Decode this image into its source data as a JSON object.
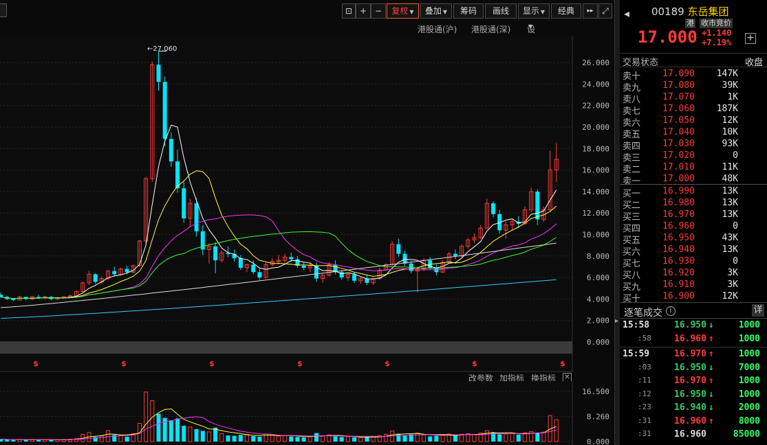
{
  "toolbar": {
    "buttons": [
      {
        "name": "lock-icon",
        "label": "⊡"
      },
      {
        "name": "zoom-in-button",
        "label": "+"
      },
      {
        "name": "zoom-out-button",
        "label": "−"
      },
      {
        "name": "fuquan-button",
        "label": "复权",
        "active": true
      },
      {
        "name": "overlay-button",
        "label": "叠加"
      },
      {
        "name": "chips-button",
        "label": "筹码"
      },
      {
        "name": "draw-button",
        "label": "画线"
      },
      {
        "name": "display-button",
        "label": "显示"
      },
      {
        "name": "classic-button",
        "label": "经典"
      },
      {
        "name": "forward-button",
        "label": "▸▸"
      },
      {
        "name": "fullscreen-button",
        "label": "⤢"
      }
    ]
  },
  "links": {
    "hk_sh": "港股通(沪)",
    "hk_sz": "港股通(深)",
    "ma_settings": "设置均线"
  },
  "indicator_bar": {
    "edit": "改参数",
    "add": "加指标",
    "switch": "换指标",
    "close": "✕"
  },
  "colors": {
    "up": "#ff3b3b",
    "down": "#00e5ff",
    "ma5": "#ffffff",
    "ma10": "#ffff33",
    "ma20": "#ff33ff",
    "ma30": "#33ff33",
    "ma60": "#dddddd",
    "ma120": "#33ccff"
  },
  "chart_data": {
    "type": "candlestick",
    "peak_label": "←27.060",
    "y_axis_ticks": [
      "26.000",
      "24.000",
      "22.000",
      "20.000",
      "18.000",
      "16.000",
      "14.000",
      "12.000",
      "10.000",
      "8.000",
      "6.000",
      "4.000",
      "2.000",
      "0.000"
    ],
    "ylim": [
      0,
      27.5
    ],
    "volume_axis_ticks": [
      "16.500",
      "8.260",
      "0.000"
    ],
    "volume_ylim": [
      0,
      16.5
    ],
    "dividend_marker": "$",
    "candles": [
      [
        4.4,
        4.6,
        4.1,
        4.2
      ],
      [
        4.2,
        4.3,
        3.9,
        4.0
      ],
      [
        4.0,
        4.1,
        3.8,
        3.9
      ],
      [
        3.9,
        4.3,
        3.9,
        4.2
      ],
      [
        4.2,
        4.2,
        3.9,
        4.0
      ],
      [
        4.0,
        4.3,
        3.9,
        4.2
      ],
      [
        4.2,
        4.4,
        4.0,
        4.1
      ],
      [
        4.1,
        4.3,
        4.0,
        4.2
      ],
      [
        4.2,
        4.3,
        3.9,
        4.0
      ],
      [
        4.0,
        4.2,
        3.9,
        4.1
      ],
      [
        4.1,
        4.3,
        4.0,
        4.2
      ],
      [
        4.2,
        4.4,
        4.1,
        4.3
      ],
      [
        4.3,
        4.8,
        4.2,
        4.7
      ],
      [
        4.7,
        5.6,
        4.6,
        5.5
      ],
      [
        5.5,
        6.6,
        5.3,
        6.3
      ],
      [
        6.3,
        6.4,
        5.4,
        5.6
      ],
      [
        5.6,
        6.1,
        5.4,
        5.9
      ],
      [
        5.9,
        6.7,
        5.8,
        6.6
      ],
      [
        6.6,
        7.0,
        6.1,
        6.3
      ],
      [
        6.3,
        6.9,
        6.2,
        6.8
      ],
      [
        6.8,
        7.1,
        6.3,
        6.5
      ],
      [
        6.5,
        7.2,
        6.4,
        7.1
      ],
      [
        7.1,
        9.5,
        7.0,
        9.4
      ],
      [
        9.4,
        15.4,
        9.2,
        15.2
      ],
      [
        15.2,
        26.1,
        14.9,
        25.8
      ],
      [
        25.8,
        27.06,
        23.4,
        24.2
      ],
      [
        24.2,
        24.7,
        18.2,
        18.9
      ],
      [
        18.9,
        19.5,
        16.3,
        16.8
      ],
      [
        16.8,
        17.9,
        13.9,
        14.3
      ],
      [
        14.3,
        14.9,
        11.1,
        11.5
      ],
      [
        11.5,
        13.3,
        10.7,
        12.9
      ],
      [
        12.9,
        13.4,
        9.8,
        10.3
      ],
      [
        10.3,
        10.9,
        8.1,
        8.6
      ],
      [
        8.6,
        9.2,
        7.3,
        8.9
      ],
      [
        8.9,
        9.3,
        6.4,
        7.6
      ],
      [
        7.6,
        8.5,
        7.4,
        8.3
      ],
      [
        8.3,
        8.9,
        7.9,
        8.2
      ],
      [
        8.2,
        8.6,
        7.5,
        7.8
      ],
      [
        7.8,
        8.1,
        6.7,
        6.9
      ],
      [
        6.9,
        7.3,
        6.5,
        7.2
      ],
      [
        7.2,
        7.6,
        6.3,
        6.5
      ],
      [
        6.5,
        6.8,
        5.8,
        6.0
      ],
      [
        6.0,
        7.5,
        5.9,
        7.2
      ],
      [
        7.2,
        7.8,
        7.0,
        7.5
      ],
      [
        7.5,
        8.1,
        7.2,
        7.6
      ],
      [
        7.6,
        8.2,
        7.4,
        7.9
      ],
      [
        7.9,
        8.3,
        7.5,
        7.7
      ],
      [
        7.7,
        8.0,
        6.9,
        7.1
      ],
      [
        7.1,
        7.4,
        6.7,
        6.9
      ],
      [
        6.9,
        7.3,
        6.5,
        7.1
      ],
      [
        7.1,
        7.4,
        5.6,
        5.9
      ],
      [
        5.9,
        6.4,
        5.5,
        6.2
      ],
      [
        6.2,
        7.4,
        6.1,
        7.2
      ],
      [
        7.2,
        7.6,
        6.3,
        6.5
      ],
      [
        6.5,
        6.7,
        5.8,
        6.0
      ],
      [
        6.0,
        6.4,
        5.7,
        6.3
      ],
      [
        6.3,
        6.5,
        5.5,
        5.7
      ],
      [
        5.7,
        6.1,
        5.4,
        5.9
      ],
      [
        5.9,
        6.2,
        5.3,
        5.5
      ],
      [
        5.5,
        6.0,
        5.3,
        5.9
      ],
      [
        5.9,
        6.9,
        5.8,
        6.7
      ],
      [
        6.7,
        7.3,
        6.6,
        7.2
      ],
      [
        7.2,
        9.4,
        7.1,
        9.1
      ],
      [
        9.1,
        9.6,
        7.9,
        8.2
      ],
      [
        8.2,
        8.5,
        7.1,
        7.3
      ],
      [
        7.3,
        7.6,
        6.4,
        6.6
      ],
      [
        6.6,
        7.0,
        4.6,
        6.8
      ],
      [
        6.8,
        7.8,
        6.6,
        7.6
      ],
      [
        7.6,
        7.9,
        6.7,
        6.9
      ],
      [
        6.9,
        7.2,
        6.2,
        6.5
      ],
      [
        6.5,
        7.6,
        6.4,
        7.4
      ],
      [
        7.4,
        8.4,
        7.3,
        8.2
      ],
      [
        8.2,
        8.6,
        7.7,
        8.0
      ],
      [
        8.0,
        9.1,
        7.9,
        8.9
      ],
      [
        8.9,
        9.7,
        8.7,
        9.5
      ],
      [
        9.5,
        10.1,
        9.2,
        9.7
      ],
      [
        9.7,
        10.9,
        9.6,
        10.6
      ],
      [
        10.6,
        13.3,
        10.5,
        12.9
      ],
      [
        12.9,
        13.1,
        11.6,
        11.9
      ],
      [
        11.9,
        12.3,
        10.1,
        10.4
      ],
      [
        10.4,
        11.2,
        9.6,
        10.9
      ],
      [
        10.9,
        11.4,
        10.4,
        11.2
      ],
      [
        11.2,
        11.7,
        10.6,
        11.0
      ],
      [
        11.0,
        12.6,
        10.9,
        12.3
      ],
      [
        12.3,
        14.4,
        12.1,
        14.0
      ],
      [
        14.0,
        14.2,
        10.9,
        11.4
      ],
      [
        11.4,
        12.6,
        11.2,
        12.3
      ],
      [
        12.3,
        17.8,
        12.2,
        16.0
      ],
      [
        16.0,
        18.5,
        14.9,
        17.0
      ]
    ],
    "volumes": [
      0.8,
      0.6,
      0.5,
      0.7,
      0.6,
      0.7,
      0.5,
      0.6,
      0.5,
      0.6,
      0.7,
      0.8,
      1.0,
      2.4,
      3.0,
      1.5,
      1.8,
      3.6,
      2.2,
      2.0,
      1.6,
      2.6,
      6.0,
      16.3,
      13.5,
      9.2,
      7.8,
      7.0,
      7.6,
      5.2,
      4.8,
      4.1,
      3.5,
      3.2,
      4.6,
      2.6,
      2.0,
      1.9,
      2.2,
      2.4,
      1.8,
      1.6,
      2.5,
      2.1,
      1.8,
      2.0,
      1.7,
      1.5,
      1.4,
      1.6,
      2.8,
      1.9,
      2.2,
      1.7,
      1.5,
      1.6,
      1.4,
      1.3,
      1.6,
      1.5,
      2.0,
      2.4,
      3.5,
      2.6,
      2.1,
      2.4,
      2.8,
      2.2,
      1.7,
      1.9,
      2.1,
      2.5,
      2.0,
      2.4,
      2.6,
      2.3,
      2.8,
      3.6,
      3.1,
      2.4,
      2.5,
      2.7,
      2.3,
      2.9,
      3.3,
      2.8,
      3.1,
      8.6,
      7.2
    ]
  },
  "quote": {
    "back": "◂",
    "code": "00189",
    "name": "东岳集团",
    "tag1": "港",
    "tag2": "收市竞价",
    "price": "17.000",
    "change": "+1.140",
    "pct": "+7.19%",
    "add": "+",
    "trade_status_label": "交易状态",
    "trade_status_value": "收盘"
  },
  "order_book": [
    {
      "label": "卖十",
      "price": "17.090",
      "vol": "147K"
    },
    {
      "label": "卖九",
      "price": "17.080",
      "vol": "39K"
    },
    {
      "label": "卖八",
      "price": "17.070",
      "vol": "1K"
    },
    {
      "label": "卖七",
      "price": "17.060",
      "vol": "187K"
    },
    {
      "label": "卖六",
      "price": "17.050",
      "vol": "12K"
    },
    {
      "label": "卖五",
      "price": "17.040",
      "vol": "10K"
    },
    {
      "label": "卖四",
      "price": "17.030",
      "vol": "93K"
    },
    {
      "label": "卖三",
      "price": "17.020",
      "vol": "0"
    },
    {
      "label": "卖二",
      "price": "17.010",
      "vol": "11K"
    },
    {
      "label": "卖一",
      "price": "17.000",
      "vol": "48K"
    },
    {
      "label": "买一",
      "price": "16.990",
      "vol": "13K"
    },
    {
      "label": "买二",
      "price": "16.980",
      "vol": "13K"
    },
    {
      "label": "买三",
      "price": "16.970",
      "vol": "13K"
    },
    {
      "label": "买四",
      "price": "16.960",
      "vol": "0"
    },
    {
      "label": "买五",
      "price": "16.950",
      "vol": "43K"
    },
    {
      "label": "买六",
      "price": "16.940",
      "vol": "13K"
    },
    {
      "label": "买七",
      "price": "16.930",
      "vol": "0"
    },
    {
      "label": "买八",
      "price": "16.920",
      "vol": "3K"
    },
    {
      "label": "买九",
      "price": "16.910",
      "vol": "3K"
    },
    {
      "label": "买十",
      "price": "16.900",
      "vol": "12K"
    }
  ],
  "ticks_panel": {
    "title": "逐笔成交",
    "info": "i",
    "detail": "详",
    "rows": [
      {
        "time": "15:58",
        "sub": false,
        "price": "16.950",
        "dir": "down",
        "arrow": "↓",
        "vol": "1000"
      },
      {
        "time": ":58",
        "sub": true,
        "price": "16.960",
        "dir": "up",
        "arrow": "↑",
        "vol": "1000"
      },
      {
        "time": "15:59",
        "sub": false,
        "price": "16.970",
        "dir": "up",
        "arrow": "↑",
        "vol": "1000"
      },
      {
        "time": ":03",
        "sub": true,
        "price": "16.950",
        "dir": "down",
        "arrow": "↓",
        "vol": "7000"
      },
      {
        "time": ":11",
        "sub": true,
        "price": "16.970",
        "dir": "up",
        "arrow": "↑",
        "vol": "1000"
      },
      {
        "time": ":12",
        "sub": true,
        "price": "16.950",
        "dir": "down",
        "arrow": "↓",
        "vol": "1000"
      },
      {
        "time": ":23",
        "sub": true,
        "price": "16.940",
        "dir": "down",
        "arrow": "↓",
        "vol": "2000"
      },
      {
        "time": ":31",
        "sub": true,
        "price": "16.960",
        "dir": "up",
        "arrow": "↑",
        "vol": "8000"
      },
      {
        "time": ":31",
        "sub": true,
        "price": "16.960",
        "dir": "flat",
        "arrow": "",
        "vol": "85000"
      }
    ]
  }
}
